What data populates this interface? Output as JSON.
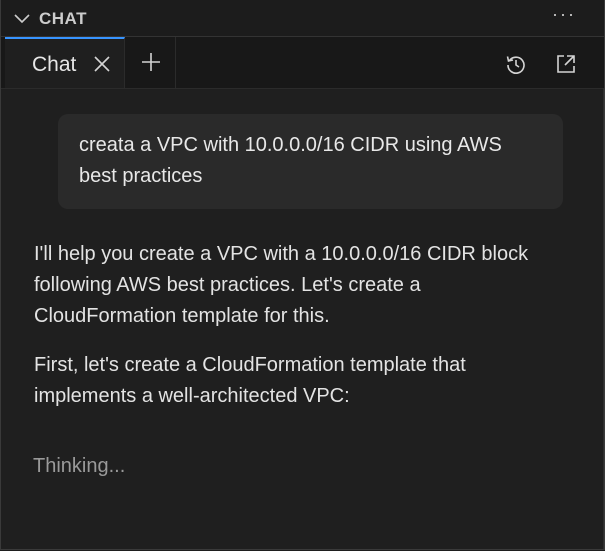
{
  "panel": {
    "title": "CHAT",
    "more_label": "···"
  },
  "tabs": [
    {
      "label": "Chat",
      "active": true
    }
  ],
  "toolbar": {
    "new_tab_icon": "plus-icon",
    "history_icon": "history-icon",
    "popout_icon": "open-in-new-window-icon"
  },
  "conversation": {
    "user_message": "creata a VPC with 10.0.0.0/16 CIDR using AWS best practices",
    "assistant_messages": [
      "I'll help you create a VPC with a 10.0.0.0/16 CIDR block following AWS best practices. Let's create a CloudFormation template for this.",
      "First, let's create a CloudFormation template that implements a well-architected VPC:"
    ],
    "status": "Thinking..."
  },
  "colors": {
    "background": "#1f1f1f",
    "bubble": "#2a2a2a",
    "accent": "#3794ff",
    "text": "#e3e3e3",
    "muted": "#9a9a9a"
  }
}
